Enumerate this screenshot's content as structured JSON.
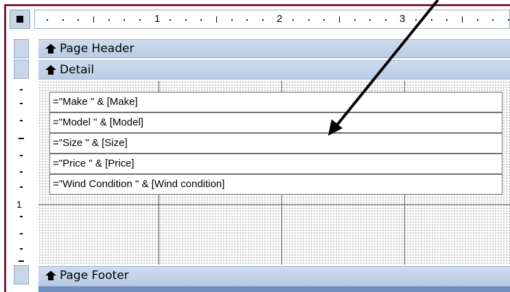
{
  "ruler": {
    "numbers": [
      "1",
      "2",
      "3"
    ]
  },
  "vertical_ruler": {
    "number": "1"
  },
  "sections": {
    "page_header": "Page Header",
    "detail": "Detail",
    "page_footer": "Page Footer"
  },
  "detail_controls": [
    "=\"Make \" & [Make]",
    "=\"Model \" & [Model]",
    "=\"Size \" & [Size]",
    "=\"Price \" & [Price]",
    "=\"Wind Condition \" & [Wind condition]"
  ],
  "icons": {
    "section_arrow": "double-up-arrow-icon",
    "annotation": "pointer-arrow"
  },
  "colors": {
    "band": "#c9d6ea",
    "frame": "#7a1f3d",
    "grid_dots": "#7a7a7a",
    "footer_strip": "#6f8fbf"
  }
}
